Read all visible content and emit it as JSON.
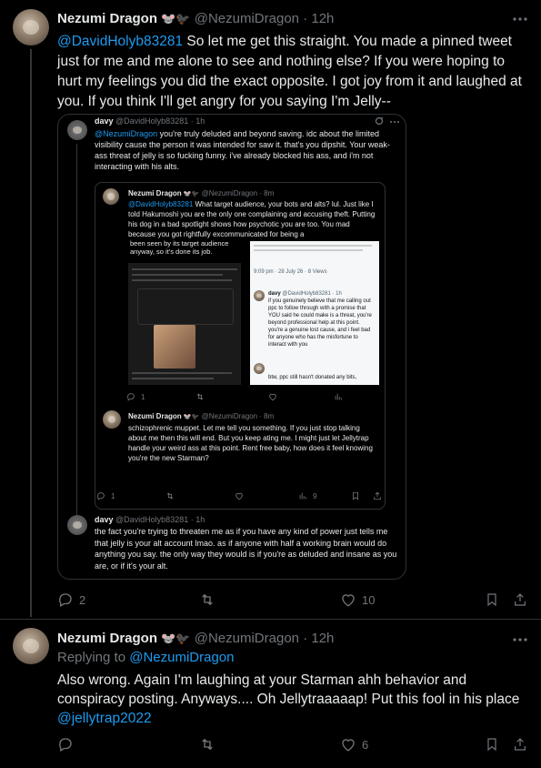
{
  "tweet1": {
    "author": "Nezumi Dragon",
    "emoji": "🐭🐦‍⬛",
    "handle": "@NezumiDragon",
    "time": "· 12h",
    "mention": "@DavidHolyb83281",
    "text": " So let me get this straight. You made a pinned tweet just for me and me alone to see and nothing else? If you were hoping to hurt my feelings you did the exact opposite. I got joy from it and laughed at you. If you think I'll get angry for you saying I'm Jelly--",
    "replies": "2",
    "likes": "10"
  },
  "quote": {
    "author": "davy",
    "handle": "@DavidHolyb83281 · 1h",
    "mention": "@NezumiDragon",
    "text": " you're truly deluded and beyond saving. idc about the limited visibility cause the person it was intended for saw it. that's you dipshit. Your weak-ass threat of jelly is so fucking funny. i've already blocked his ass, and i'm not interacting with his alts.",
    "nested": {
      "author": "Nezumi Dragon",
      "emoji": "🐭🐦‍⬛",
      "handle": "@NezumiDragon · 8m",
      "mention": "@DavidHolyb83281",
      "text": " What target audience, your bots and alts? lul. Just like I told Hakumoshi you are the only one complaining and accusing theft. Putting his dog in a bad spotlight shows how psychotic you are too. You mad because you got rightfully excommunicated for being a",
      "overlay_text": "been seen by its target audience anyway, so it's done its job.",
      "replies": "1",
      "shot_right": {
        "meta": "9:09 pm · 28 July 26 · 8 Views",
        "reply_author": "davy",
        "reply_handle": "@DavidHolyb83281 · 1h",
        "reply_text": "if you genuinely believe that me calling out ppc to follow through with a promise that YOU said he could make is a threat, you're beyond professional help at this point. you're a genuine lost cause, and i feel bad for anyone who has the misfortune to interact with you",
        "reply2_text": "btw, ppc still hasn't donated any bits,"
      }
    },
    "reply": {
      "author": "Nezumi Dragon",
      "emoji": "🐭🐦‍⬛",
      "handle": "@NezumiDragon · 8m",
      "text": "schizophrenic muppet. Let me tell you something. If you just stop talking about me then this will end. But you keep ating me. I might just let Jellytrap handle your weird ass at this point. Rent free baby, how does it feel knowing you're the new Starman?",
      "replies": "1",
      "views": "9"
    },
    "final": {
      "author": "davy",
      "handle": "@DavidHolyb83281 · 1h",
      "text": "the fact you're trying to threaten me as if you have any kind of power just tells me that jelly is your alt account lmao. as if anyone with half a working brain would do anything you say. the only way they would is if you're as deluded and insane as you are, or if it's your alt."
    }
  },
  "tweet2": {
    "author": "Nezumi Dragon",
    "emoji": "🐭🐦‍⬛",
    "handle": "@NezumiDragon",
    "time": "· 12h",
    "replying_label": "Replying to ",
    "replying_to": "@NezumiDragon",
    "text": "Also wrong. Again I'm laughing at your Starman ahh behavior and conspiracy posting. Anyways.... Oh Jellytraaaaap! Put this fool in his place ",
    "mention": "@jellytrap2022",
    "likes": "6"
  }
}
